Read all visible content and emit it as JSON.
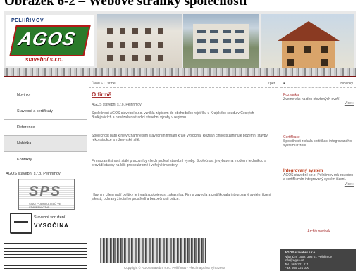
{
  "caption": "Obrázek 6-2 – Webové stránky společnosti",
  "logo": {
    "town": "PELHŘIMOV",
    "brand": "AGOS",
    "sub": "stavební s.r.o."
  },
  "nav": {
    "items": [
      {
        "label": "Novinky"
      },
      {
        "label": "Stavební a certifikáty"
      },
      {
        "label": "Reference"
      },
      {
        "label": "Nabídka"
      },
      {
        "label": "Kontakty"
      }
    ]
  },
  "sidebar": {
    "prekl": "AGOS stavební s.r.o. Pelhřimov",
    "sps_label": "SPS",
    "sps_sub": "SVAZ PODNIKATELŮ VE STAVEBNICTVÍ",
    "svaz_line1": "Stavební sdružení",
    "svaz_line2": "VYSOČINA"
  },
  "center": {
    "breadcrumb": "Úvod » O firmě",
    "back": "Zpět",
    "title": "O firmě",
    "paragraphs": [
      "AGOS stavební s.r.o. Pelhřimov",
      "Společnost AGOS stavební s.r.o. vznikla zápisem do obchodního rejstříku u Krajského soudu v Českých Budějovicích a navázala na tradici stavební výroby v regionu.",
      "Společnost patří k nejvýznamnějším stavebním firmám kraje Vysočina. Rozsah činnosti zahrnuje pozemní stavby, rekonstrukce a inženýrské sítě.",
      "Firma zaměstnává stálé pracovníky všech profesí stavební výroby. Společnost je vybavena moderní technikou a provádí stavby na klíč pro soukromé i veřejné investory.",
      "Hlavním cílem naší politiky je trvalá spokojenost zákazníka. Firma zavedla a certifikovala integrovaný systém řízení jakosti, ochrany životního prostředí a bezpečnosti práce."
    ],
    "copyright": "Copyright © AGOS stavební s.r.o. Pelhřimov · všechna práva vyhrazena"
  },
  "right": {
    "header": "Novinky",
    "news": [
      {
        "title": "Pozvánka",
        "text": "Zveme vás na den otevřených dveří."
      },
      {
        "title": "Certifikace",
        "text": "Společnost získala certifikaci integrovaného systému řízení."
      },
      {
        "title": "Integrovaný systém",
        "text": "AGOS stavební s.r.o. Pelhřimov má zaveden a certifikován integrovaný systém řízení."
      }
    ],
    "more_label": "Více »",
    "archive": "Archiv novinek",
    "contact": {
      "name": "AGOS stavební s.r.o.",
      "address": "Nádražní 1552, 393 01 Pelhřimov",
      "email": "info@agos.cz",
      "phone": "Tel.: 565 321 111",
      "fax": "Fax: 565 321 000"
    }
  }
}
